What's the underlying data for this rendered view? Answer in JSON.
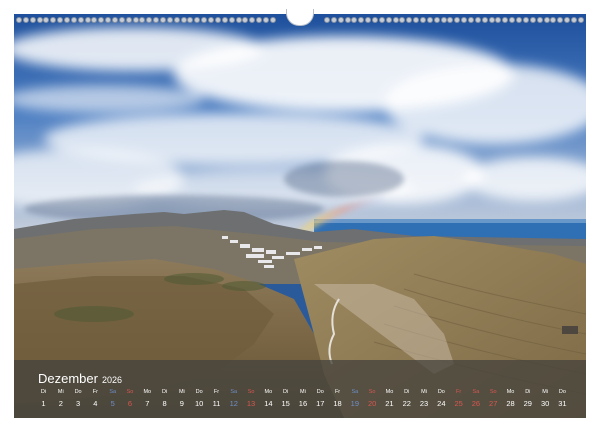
{
  "calendar": {
    "month": "Dezember",
    "year": "2026",
    "days": [
      {
        "wd": "Di",
        "num": "1",
        "type": "work"
      },
      {
        "wd": "Mi",
        "num": "2",
        "type": "work"
      },
      {
        "wd": "Do",
        "num": "3",
        "type": "work"
      },
      {
        "wd": "Fr",
        "num": "4",
        "type": "work"
      },
      {
        "wd": "Sa",
        "num": "5",
        "type": "weekend"
      },
      {
        "wd": "So",
        "num": "6",
        "type": "holiday"
      },
      {
        "wd": "Mo",
        "num": "7",
        "type": "work"
      },
      {
        "wd": "Di",
        "num": "8",
        "type": "work"
      },
      {
        "wd": "Mi",
        "num": "9",
        "type": "work"
      },
      {
        "wd": "Do",
        "num": "10",
        "type": "work"
      },
      {
        "wd": "Fr",
        "num": "11",
        "type": "work"
      },
      {
        "wd": "Sa",
        "num": "12",
        "type": "weekend"
      },
      {
        "wd": "So",
        "num": "13",
        "type": "holiday"
      },
      {
        "wd": "Mo",
        "num": "14",
        "type": "work"
      },
      {
        "wd": "Di",
        "num": "15",
        "type": "work"
      },
      {
        "wd": "Mi",
        "num": "16",
        "type": "work"
      },
      {
        "wd": "Do",
        "num": "17",
        "type": "work"
      },
      {
        "wd": "Fr",
        "num": "18",
        "type": "work"
      },
      {
        "wd": "Sa",
        "num": "19",
        "type": "weekend"
      },
      {
        "wd": "So",
        "num": "20",
        "type": "holiday"
      },
      {
        "wd": "Mo",
        "num": "21",
        "type": "work"
      },
      {
        "wd": "Di",
        "num": "22",
        "type": "work"
      },
      {
        "wd": "Mi",
        "num": "23",
        "type": "work"
      },
      {
        "wd": "Do",
        "num": "24",
        "type": "work"
      },
      {
        "wd": "Fr",
        "num": "25",
        "type": "holiday"
      },
      {
        "wd": "Sa",
        "num": "26",
        "type": "holiday"
      },
      {
        "wd": "So",
        "num": "27",
        "type": "holiday"
      },
      {
        "wd": "Mo",
        "num": "28",
        "type": "work"
      },
      {
        "wd": "Di",
        "num": "29",
        "type": "work"
      },
      {
        "wd": "Mi",
        "num": "30",
        "type": "work"
      },
      {
        "wd": "Do",
        "num": "31",
        "type": "work"
      }
    ]
  },
  "colors": {
    "weekend": "#6f8fc8",
    "holiday": "#d9574f",
    "strip": "#46443e"
  },
  "binding": {
    "left_holes": 38,
    "right_holes": 38
  }
}
